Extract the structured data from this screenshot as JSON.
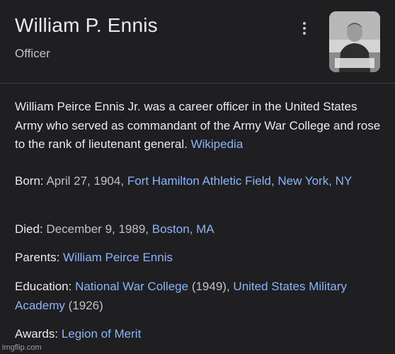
{
  "header": {
    "title": "William P. Ennis",
    "subtitle": "Officer"
  },
  "description": {
    "text": "William Peirce Ennis Jr. was a career officer in the United States Army who served as commandant of the Army War College and rose to the rank of lieutenant general.",
    "source_link": "Wikipedia"
  },
  "facts": {
    "born": {
      "label": "Born:",
      "date": "April 27, 1904,",
      "place_link": "Fort Hamilton Athletic Field, New York, NY"
    },
    "died": {
      "label": "Died:",
      "date": "December 9, 1989,",
      "place_link": "Boston, MA"
    },
    "parents": {
      "label": "Parents:",
      "link": "William Peirce Ennis"
    },
    "education": {
      "label": "Education:",
      "school1_link": "National War College",
      "school1_year": "(1949),",
      "school2_link": "United States Military Academy",
      "school2_year": "(1926)"
    },
    "awards": {
      "label": "Awards:",
      "link": "Legion of Merit"
    }
  },
  "watermark": "imgflip.com",
  "colors": {
    "background": "#1f1f21",
    "link": "#8ab4f8",
    "text": "#e8eaed",
    "muted": "#bdc1c6"
  },
  "icons": {
    "more": "more-vert-icon"
  }
}
